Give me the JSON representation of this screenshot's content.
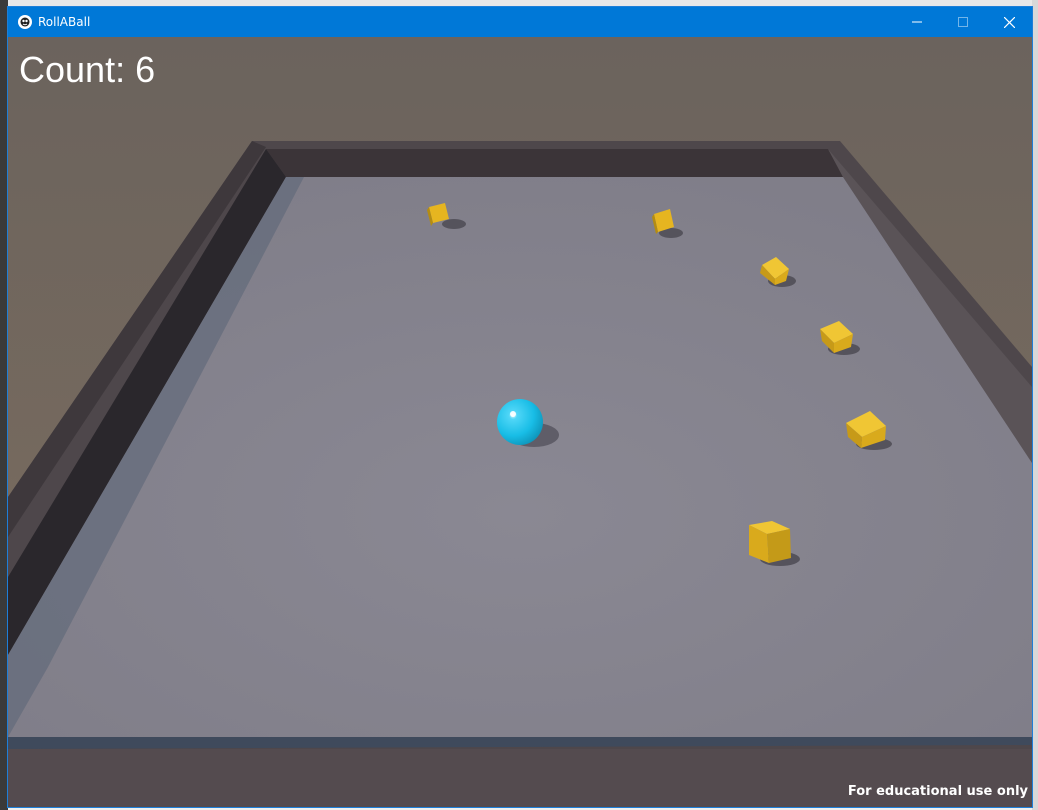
{
  "window": {
    "title": "RollABall",
    "accent_color": "#0078d7",
    "controls": {
      "minimize_icon": "minimize-icon",
      "maximize_icon": "maximize-icon",
      "close_icon": "close-icon"
    }
  },
  "hud": {
    "count_label": "Count: ",
    "count_value": "6"
  },
  "watermark": "For educational use only",
  "scene": {
    "player_color": "#1ec3ef",
    "pickup_color": "#e0b020",
    "ground_color": "#85838c",
    "wall_color": "#4a4348",
    "pickups_remaining": 6
  }
}
